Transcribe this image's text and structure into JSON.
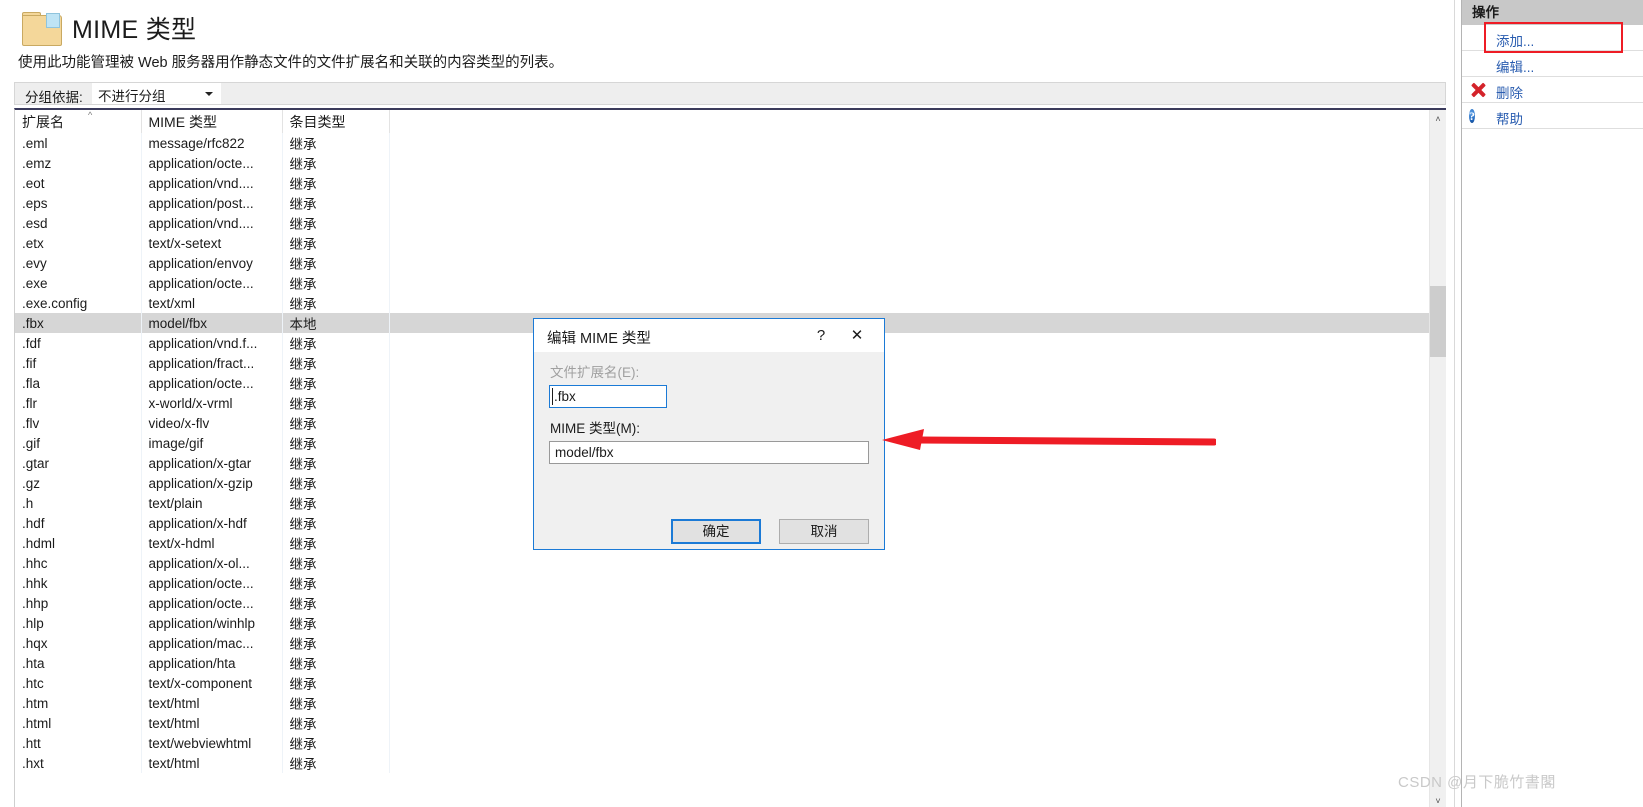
{
  "header": {
    "title": "MIME 类型",
    "description": "使用此功能管理被 Web 服务器用作静态文件的文件扩展名和关联的内容类型的列表。",
    "icon": "folder-icon"
  },
  "toolbar": {
    "group_by_label": "分组依据:",
    "group_by_value": "不进行分组",
    "group_by_options": [
      "不进行分组"
    ]
  },
  "table": {
    "columns": [
      "扩展名",
      "MIME 类型",
      "条目类型"
    ],
    "sort_column": "扩展名",
    "sort_caret": "^",
    "selected_row_index": 9,
    "rows": [
      {
        "ext": ".eml",
        "mime": "message/rfc822",
        "kind": "继承"
      },
      {
        "ext": ".emz",
        "mime": "application/octe...",
        "kind": "继承"
      },
      {
        "ext": ".eot",
        "mime": "application/vnd....",
        "kind": "继承"
      },
      {
        "ext": ".eps",
        "mime": "application/post...",
        "kind": "继承"
      },
      {
        "ext": ".esd",
        "mime": "application/vnd....",
        "kind": "继承"
      },
      {
        "ext": ".etx",
        "mime": "text/x-setext",
        "kind": "继承"
      },
      {
        "ext": ".evy",
        "mime": "application/envoy",
        "kind": "继承"
      },
      {
        "ext": ".exe",
        "mime": "application/octe...",
        "kind": "继承"
      },
      {
        "ext": ".exe.config",
        "mime": "text/xml",
        "kind": "继承"
      },
      {
        "ext": ".fbx",
        "mime": "model/fbx",
        "kind": "本地"
      },
      {
        "ext": ".fdf",
        "mime": "application/vnd.f...",
        "kind": "继承"
      },
      {
        "ext": ".fif",
        "mime": "application/fract...",
        "kind": "继承"
      },
      {
        "ext": ".fla",
        "mime": "application/octe...",
        "kind": "继承"
      },
      {
        "ext": ".flr",
        "mime": "x-world/x-vrml",
        "kind": "继承"
      },
      {
        "ext": ".flv",
        "mime": "video/x-flv",
        "kind": "继承"
      },
      {
        "ext": ".gif",
        "mime": "image/gif",
        "kind": "继承"
      },
      {
        "ext": ".gtar",
        "mime": "application/x-gtar",
        "kind": "继承"
      },
      {
        "ext": ".gz",
        "mime": "application/x-gzip",
        "kind": "继承"
      },
      {
        "ext": ".h",
        "mime": "text/plain",
        "kind": "继承"
      },
      {
        "ext": ".hdf",
        "mime": "application/x-hdf",
        "kind": "继承"
      },
      {
        "ext": ".hdml",
        "mime": "text/x-hdml",
        "kind": "继承"
      },
      {
        "ext": ".hhc",
        "mime": "application/x-ol...",
        "kind": "继承"
      },
      {
        "ext": ".hhk",
        "mime": "application/octe...",
        "kind": "继承"
      },
      {
        "ext": ".hhp",
        "mime": "application/octe...",
        "kind": "继承"
      },
      {
        "ext": ".hlp",
        "mime": "application/winhlp",
        "kind": "继承"
      },
      {
        "ext": ".hqx",
        "mime": "application/mac...",
        "kind": "继承"
      },
      {
        "ext": ".hta",
        "mime": "application/hta",
        "kind": "继承"
      },
      {
        "ext": ".htc",
        "mime": "text/x-component",
        "kind": "继承"
      },
      {
        "ext": ".htm",
        "mime": "text/html",
        "kind": "继承"
      },
      {
        "ext": ".html",
        "mime": "text/html",
        "kind": "继承"
      },
      {
        "ext": ".htt",
        "mime": "text/webviewhtml",
        "kind": "继承"
      },
      {
        "ext": ".hxt",
        "mime": "text/html",
        "kind": "继承"
      }
    ]
  },
  "scrollbar": {
    "up_arrow": "˄",
    "down_arrow": "˅"
  },
  "actions": {
    "title": "操作",
    "items": [
      {
        "label": "添加...",
        "icon": "none",
        "highlighted": true
      },
      {
        "label": "编辑...",
        "icon": "none",
        "highlighted": false
      },
      {
        "label": "删除",
        "icon": "red-x-icon",
        "highlighted": false
      },
      {
        "label": "帮助",
        "icon": "help-question-icon",
        "highlighted": false
      }
    ],
    "highlight_color": "#ee1c25",
    "link_color": "#2a5db0"
  },
  "dialog": {
    "title": "编辑 MIME 类型",
    "help_glyph": "?",
    "close_glyph": "✕",
    "extension_label": "文件扩展名(E):",
    "extension_value": ".fbx",
    "extension_disabled": true,
    "mime_label": "MIME 类型(M):",
    "mime_value": "model/fbx",
    "ok_label": "确定",
    "cancel_label": "取消",
    "focus_color": "#1b7ad6"
  },
  "annotation": {
    "arrow_color": "#ee1c25",
    "arrow_direction": "left"
  },
  "watermark": {
    "text": "CSDN @月下脆竹書閣"
  }
}
